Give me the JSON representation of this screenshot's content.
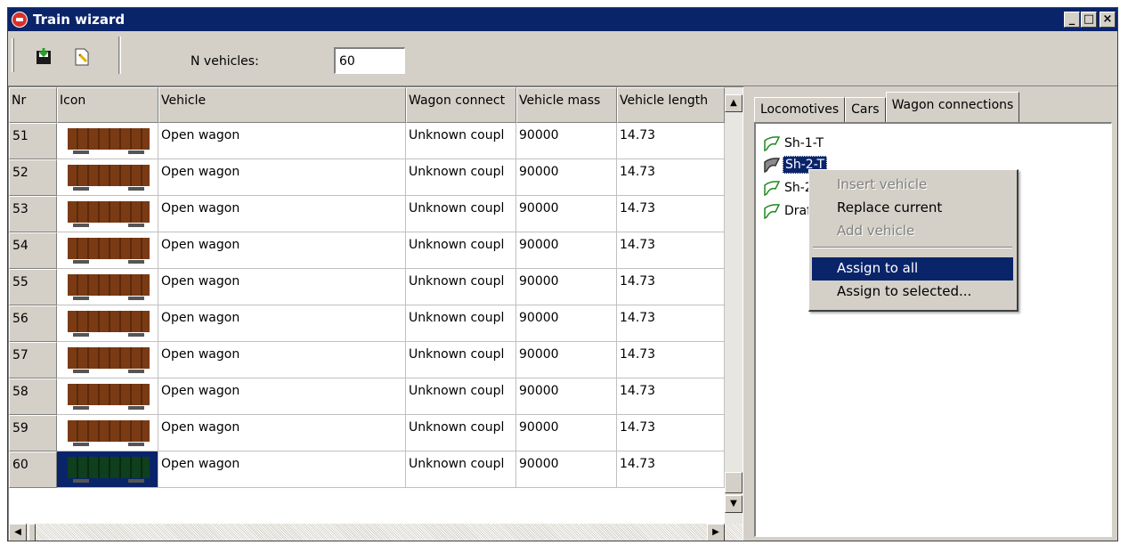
{
  "window": {
    "title": "Train wizard"
  },
  "toolbar": {
    "n_vehicles_label": "N vehicles:",
    "n_vehicles_value": "60"
  },
  "grid": {
    "columns": [
      "Nr",
      "Icon",
      "Vehicle",
      "Wagon connect",
      "Vehicle mass",
      "Vehicle length"
    ],
    "rows": [
      {
        "nr": "51",
        "vehicle": "Open wagon",
        "connection": "Unknown coupl",
        "mass": "90000",
        "length": "14.73"
      },
      {
        "nr": "52",
        "vehicle": "Open wagon",
        "connection": "Unknown coupl",
        "mass": "90000",
        "length": "14.73"
      },
      {
        "nr": "53",
        "vehicle": "Open wagon",
        "connection": "Unknown coupl",
        "mass": "90000",
        "length": "14.73"
      },
      {
        "nr": "54",
        "vehicle": "Open wagon",
        "connection": "Unknown coupl",
        "mass": "90000",
        "length": "14.73"
      },
      {
        "nr": "55",
        "vehicle": "Open wagon",
        "connection": "Unknown coupl",
        "mass": "90000",
        "length": "14.73"
      },
      {
        "nr": "56",
        "vehicle": "Open wagon",
        "connection": "Unknown coupl",
        "mass": "90000",
        "length": "14.73"
      },
      {
        "nr": "57",
        "vehicle": "Open wagon",
        "connection": "Unknown coupl",
        "mass": "90000",
        "length": "14.73"
      },
      {
        "nr": "58",
        "vehicle": "Open wagon",
        "connection": "Unknown coupl",
        "mass": "90000",
        "length": "14.73"
      },
      {
        "nr": "59",
        "vehicle": "Open wagon",
        "connection": "Unknown coupl",
        "mass": "90000",
        "length": "14.73"
      },
      {
        "nr": "60",
        "vehicle": "Open wagon",
        "connection": "Unknown coupl",
        "mass": "90000",
        "length": "14.73"
      }
    ]
  },
  "tabs": [
    "Locomotives",
    "Cars",
    "Wagon connections"
  ],
  "tree": [
    "Sh-1-T",
    "Sh-2-T",
    "Sh-2",
    "Draf"
  ],
  "context_menu": {
    "items": [
      "Insert vehicle",
      "Replace current",
      "Add vehicle",
      "Assign to all",
      "Assign to selected..."
    ]
  },
  "colors": {
    "title_bar": "#0a246a",
    "selection": "#0a246a",
    "chrome": "#d4d0c8",
    "wagon_brown": "#7a3a14"
  }
}
